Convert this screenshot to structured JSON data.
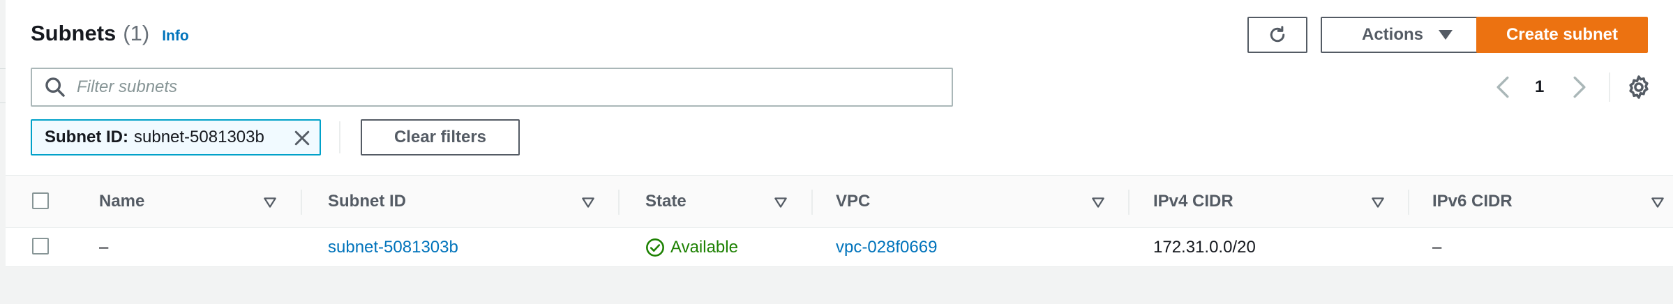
{
  "header": {
    "title": "Subnets",
    "count": "(1)",
    "info": "Info"
  },
  "toolbar": {
    "actions_label": "Actions",
    "create_label": "Create subnet"
  },
  "search": {
    "placeholder": "Filter subnets"
  },
  "pagination": {
    "current_page": "1"
  },
  "filter_token": {
    "key": "Subnet ID:",
    "value": "subnet-5081303b"
  },
  "clear_filters_label": "Clear filters",
  "table": {
    "columns": [
      "Name",
      "Subnet ID",
      "State",
      "VPC",
      "IPv4 CIDR",
      "IPv6 CIDR"
    ],
    "rows": [
      {
        "name": "–",
        "subnet_id": "subnet-5081303b",
        "state": "Available",
        "vpc": "vpc-028f0669",
        "ipv4_cidr": "172.31.0.0/20",
        "ipv6_cidr": "–"
      }
    ]
  },
  "colors": {
    "primary": "#ec7211",
    "link": "#0073bb",
    "success": "#1d8102",
    "token_border": "#00a1c9"
  },
  "icons": [
    "refresh-icon",
    "caret-down-icon",
    "search-icon",
    "chevron-left-icon",
    "chevron-right-icon",
    "gear-icon",
    "close-icon",
    "sort-icon",
    "status-ok-icon"
  ]
}
